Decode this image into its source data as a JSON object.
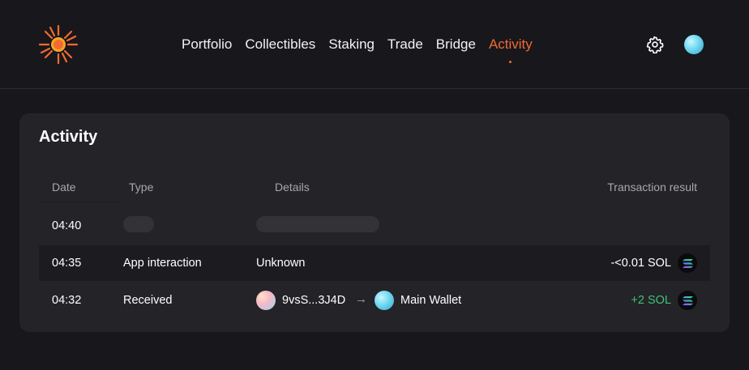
{
  "nav": {
    "items": [
      {
        "label": "Portfolio"
      },
      {
        "label": "Collectibles"
      },
      {
        "label": "Staking"
      },
      {
        "label": "Trade"
      },
      {
        "label": "Bridge"
      },
      {
        "label": "Activity",
        "active": true
      }
    ]
  },
  "colors": {
    "accent": "#f26a32",
    "positive": "#3ec27a",
    "background": "#18171c",
    "card": "#242328"
  },
  "icons": {
    "logo": "sun-burst-logo",
    "settings": "gear-icon",
    "account": "avatar",
    "token": "solana-icon"
  },
  "activity": {
    "title": "Activity",
    "columns": {
      "date": "Date",
      "type": "Type",
      "details": "Details",
      "result": "Transaction result"
    },
    "rows": [
      {
        "date": "04:40",
        "loading": true
      },
      {
        "date": "04:35",
        "type": "App interaction",
        "details": "Unknown",
        "result": "-<0.01 SOL"
      },
      {
        "date": "04:32",
        "type": "Received",
        "from": "9vsS...3J4D",
        "to": "Main Wallet",
        "result": "+2 SOL"
      }
    ]
  }
}
